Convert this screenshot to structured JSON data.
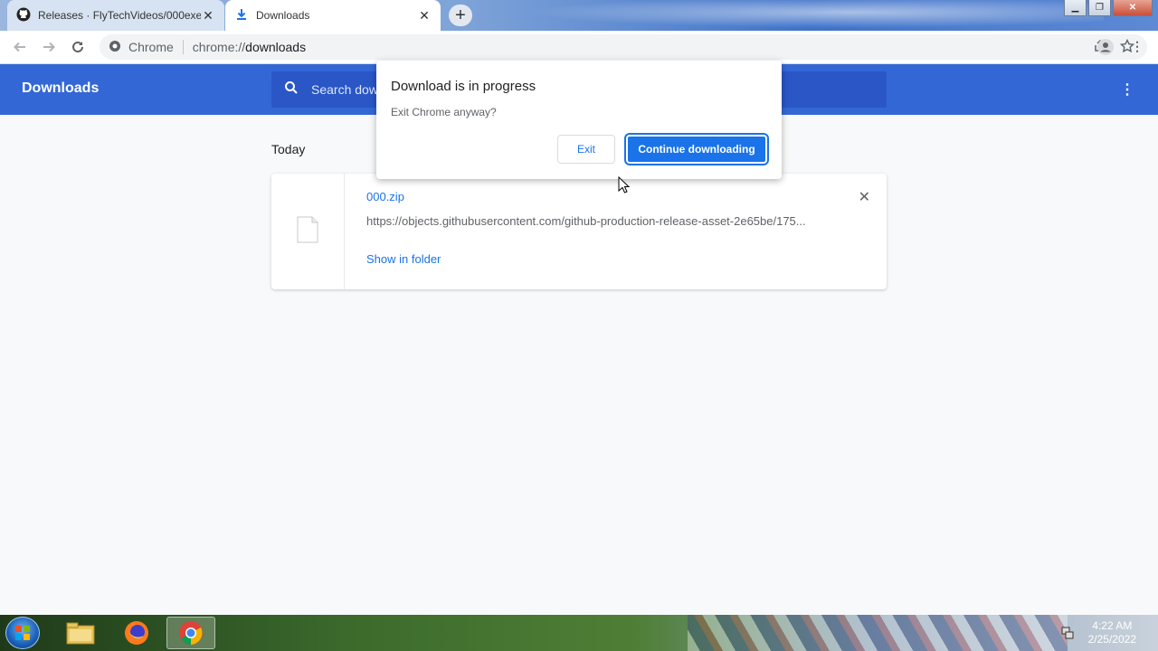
{
  "tabs": [
    {
      "title": "Releases · FlyTechVideos/000exe",
      "icon": "github-icon"
    },
    {
      "title": "Downloads",
      "icon": "download-icon"
    }
  ],
  "toolbar": {
    "site_chip": "Chrome",
    "url_scheme": "chrome://",
    "url_path": "downloads"
  },
  "downloads": {
    "header_title": "Downloads",
    "search_placeholder": "Search downloads",
    "section": "Today",
    "items": [
      {
        "file_name": "000.zip",
        "url": "https://objects.githubusercontent.com/github-production-release-asset-2e65be/175...",
        "action": "Show in folder"
      }
    ]
  },
  "dialog": {
    "title": "Download is in progress",
    "message": "Exit Chrome anyway?",
    "exit_label": "Exit",
    "continue_label": "Continue downloading"
  },
  "taskbar": {
    "time": "4:22 AM",
    "date": "2/25/2022",
    "apps": [
      "file-explorer-icon",
      "firefox-icon",
      "chrome-icon"
    ]
  },
  "colors": {
    "header_blue": "#3367d6",
    "link_blue": "#1a73e8"
  }
}
